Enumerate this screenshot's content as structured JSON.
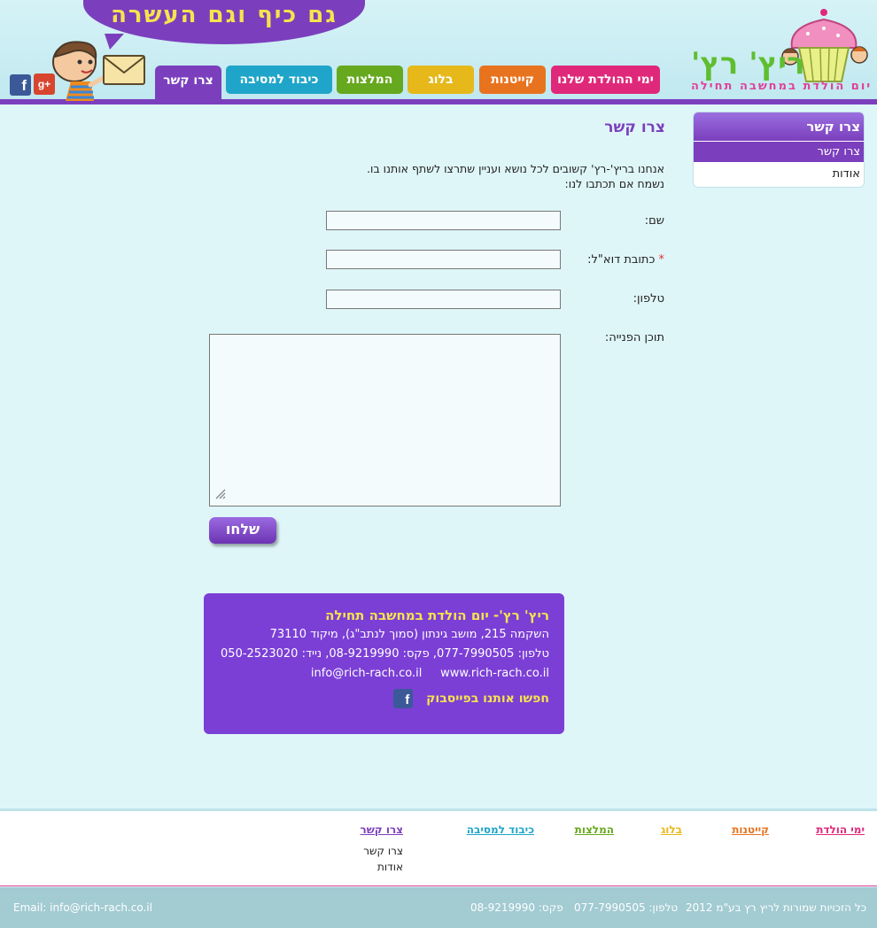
{
  "header": {
    "slogan": "גם כיף וגם העשרה",
    "logo_title": "ריץ' רץ'",
    "logo_subtitle": "יום הולדת במחשבה תחילה"
  },
  "nav": {
    "birthdays": "ימי ההולדת שלנו",
    "catering": "קייטנות",
    "blog": "בלוג",
    "recommendations": "המלצות",
    "party_hosting": "כיבוד למסיבה",
    "contact": "צרו קשר"
  },
  "colors": {
    "purple": "#7b3fbd",
    "magenta": "#e0287a",
    "orange": "#e8731e",
    "yellow": "#e6b81a",
    "green": "#66a81e",
    "teal": "#1fa5c9",
    "accent_yellow": "#f7e34c"
  },
  "sidebar": {
    "title": "צרו קשר",
    "items": [
      "צרו קשר",
      "אודות"
    ]
  },
  "main": {
    "page_title": "צרו קשר",
    "intro_line1": "אנחנו בריץ'-רץ' קשובים לכל נושא ועניין שתרצו לשתף אותנו בו.",
    "intro_line2": "נשמח אם תכתבו לנו:"
  },
  "form": {
    "name_label": "שם:",
    "email_label": "כתובת דוא\"ל:",
    "required_mark": "*",
    "phone_label": "טלפון:",
    "message_label": "תוכן הפנייה:",
    "submit_label": "שלחו"
  },
  "contact_info": {
    "title": "ריץ' רץ'- יום הולדת במחשבה תחילה",
    "address": "השקמה 215, מושב גינתון (סמוך לנתב\"ג), מיקוד 73110",
    "phones": "טלפון: 077-7990505, פקס: 08-9219990, נייד: 050-2523020",
    "website": "www.rich-rach.co.il",
    "email": "info@rich-rach.co.il",
    "facebook_label": "חפשו אותנו בפייסבוק"
  },
  "footer_links": {
    "birthdays": "ימי הולדת",
    "catering": "קייטנות",
    "blog": "בלוג",
    "recommendations": "המלצות",
    "party_hosting": "כיבוד למסיבה",
    "contact": "צרו קשר",
    "contact_sub": [
      "צרו קשר",
      "אודות"
    ]
  },
  "footer": {
    "copyright": "כל הזכויות שמורות לריץ רץ בע\"מ 2012",
    "phone": "טלפון: 077-7990505",
    "fax": "פקס: 08-9219990",
    "email": "Email: info@rich-rach.co.il"
  },
  "icons": {
    "facebook": "facebook-icon",
    "google_plus": "google-plus-icon",
    "envelope": "envelope-icon",
    "mascot": "boy-mascot-icon",
    "cupcake": "cupcake-logo-icon"
  }
}
